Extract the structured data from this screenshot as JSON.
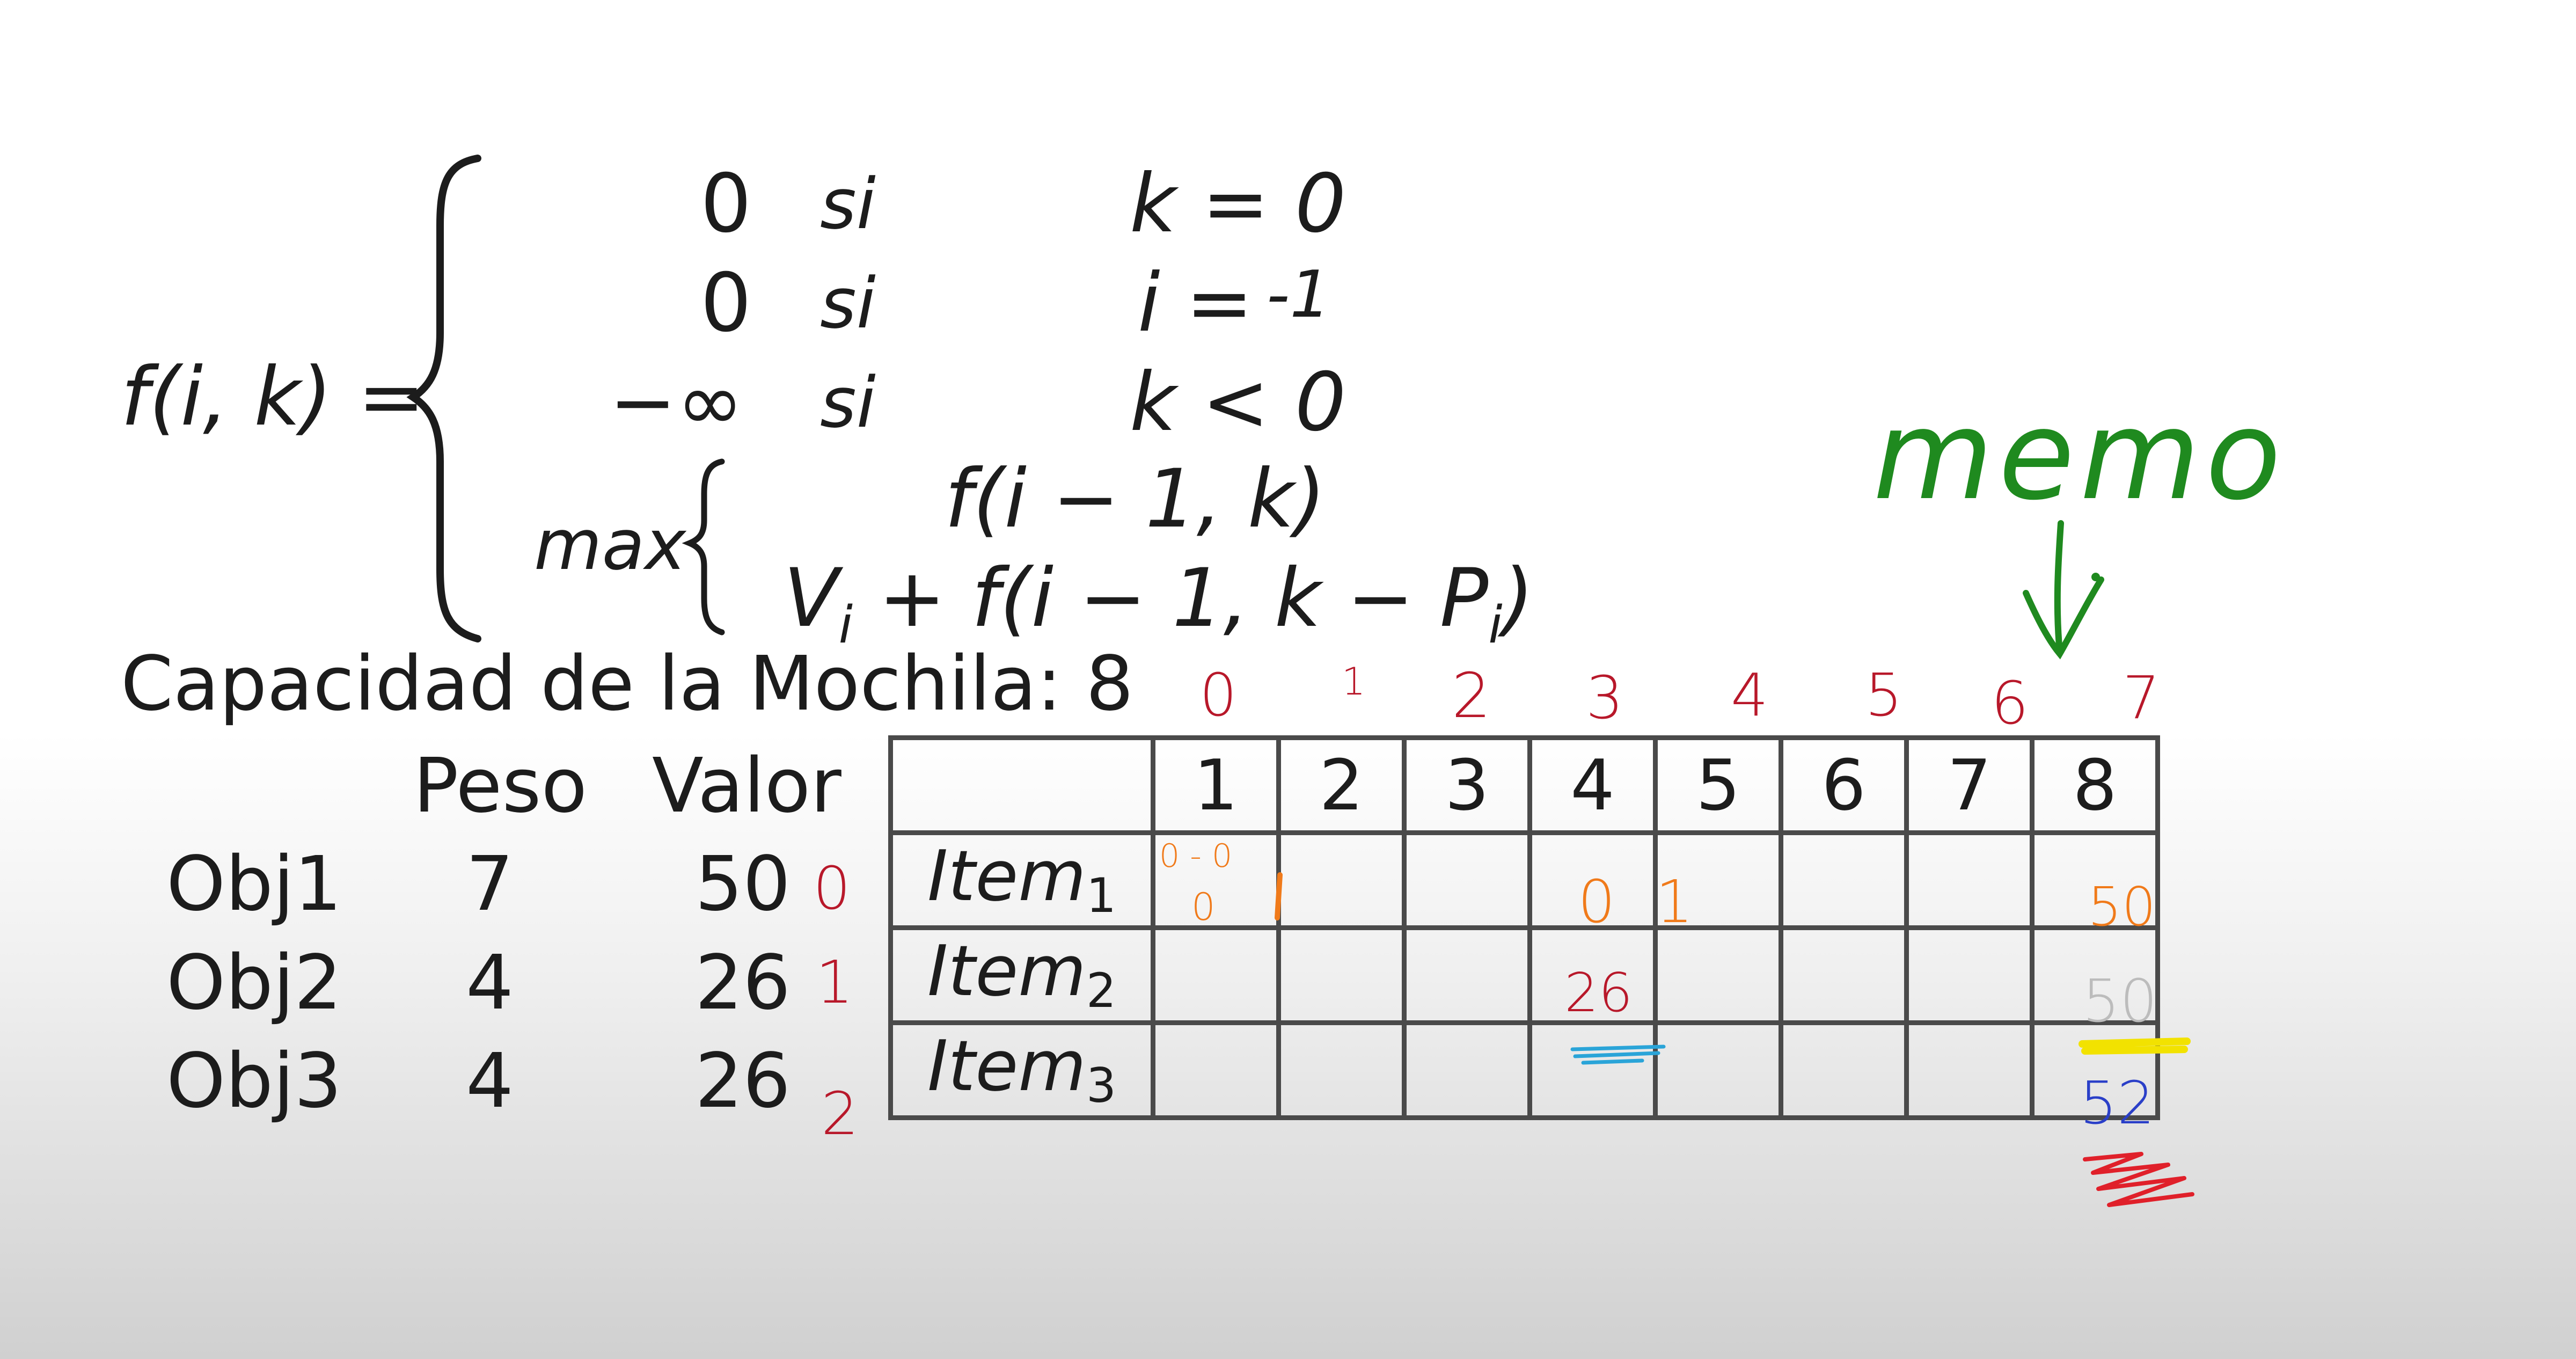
{
  "formula": {
    "lhs": "f(i, k) =",
    "cases": [
      {
        "value": "0",
        "cond_word": "si",
        "cond": "k = 0"
      },
      {
        "value": "0",
        "cond_word": "si",
        "cond": "i = "
      },
      {
        "value": "−∞",
        "cond_word": "si",
        "cond": "k < 0"
      }
    ],
    "max_word": "max",
    "max_options": [
      "f(i − 1, k)",
      "V",
      "i",
      " + f(i − 1, k − P",
      "i",
      ")"
    ]
  },
  "capacity_line": "Capacidad de la Mochila: 8",
  "objects_table": {
    "headers": [
      "Peso",
      "Valor"
    ],
    "rows": [
      {
        "name": "Obj1",
        "peso": "7",
        "valor": "50"
      },
      {
        "name": "Obj2",
        "peso": "4",
        "valor": "26"
      },
      {
        "name": "Obj3",
        "peso": "4",
        "valor": "26"
      }
    ]
  },
  "dp_table": {
    "columns": [
      "1",
      "2",
      "3",
      "4",
      "5",
      "6",
      "7",
      "8"
    ],
    "rows": [
      {
        "label": "Item",
        "sub": "1"
      },
      {
        "label": "Item",
        "sub": "2"
      },
      {
        "label": "Item",
        "sub": "3"
      }
    ]
  },
  "handwritten": {
    "i_eq_value": "-1",
    "memo": "memo",
    "column_indices": [
      "0",
      "1",
      "2",
      "3",
      "4",
      "5",
      "6",
      "7"
    ],
    "row_indices": [
      "0",
      "1",
      "2"
    ],
    "cell_notes": {
      "r0_c1_top": "0 - 0",
      "r0_c1_bottom": "0",
      "r0_c4": "0 1",
      "r0_c8": "50",
      "r1_c4": "26",
      "r1_c8": "50",
      "r2_c8": "52"
    },
    "colors": {
      "green": "#1f8a1f",
      "red": "#b8182a",
      "orange": "#f07a1a",
      "blue": "#2a3fc8",
      "gray": "#bcbcbc",
      "yellow": "#f2e200",
      "cyan": "#2aa4d8",
      "bright_red": "#e0202a"
    }
  }
}
